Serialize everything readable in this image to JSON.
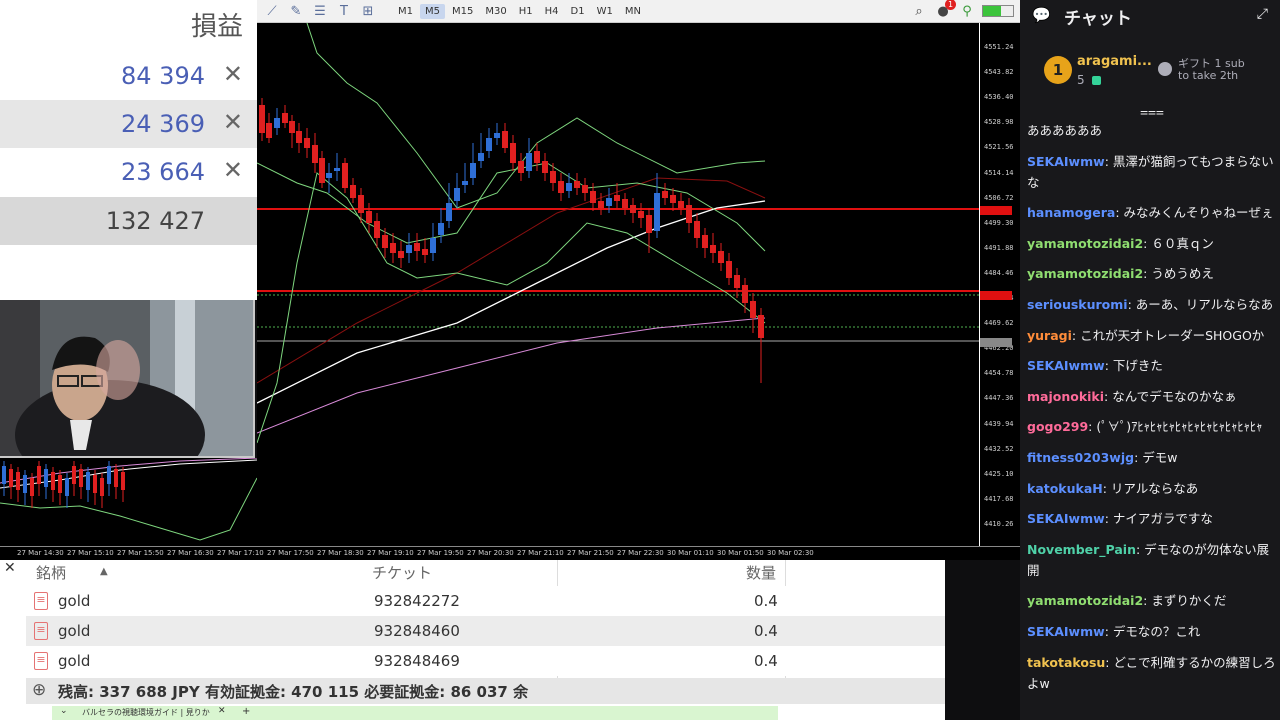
{
  "profit": {
    "header": "損益",
    "rows": [
      {
        "value": "84 394",
        "close": "✕"
      },
      {
        "value": "24 369",
        "close": "✕"
      },
      {
        "value": "23 664",
        "close": "✕"
      }
    ],
    "total": "132 427"
  },
  "toolbar": {
    "timeframes": [
      "M1",
      "M5",
      "M15",
      "M30",
      "H1",
      "H4",
      "D1",
      "W1",
      "MN"
    ],
    "active": "M5",
    "notification_count": "1"
  },
  "chart": {
    "prices": [
      "4551.24",
      "4543.82",
      "4536.40",
      "4528.98",
      "4521.56",
      "4514.14",
      "4506.72",
      "4499.30",
      "4491.88",
      "4484.46",
      "4477.04",
      "4469.62",
      "4462.20",
      "4454.78",
      "4447.36",
      "4439.94",
      "4432.52",
      "4425.10",
      "4417.68",
      "4410.26"
    ],
    "times": [
      "27 Mar 14:30",
      "27 Mar 15:10",
      "27 Mar 15:50",
      "27 Mar 16:30",
      "27 Mar 17:10",
      "27 Mar 17:50",
      "27 Mar 18:30",
      "27 Mar 19:10",
      "27 Mar 19:50",
      "27 Mar 20:30",
      "27 Mar 21:10",
      "27 Mar 21:50",
      "27 Mar 22:30",
      "30 Mar 01:10",
      "30 Mar 01:50",
      "30 Mar 02:30"
    ],
    "colors": {
      "up": "#2f6fd6",
      "down": "#e02020",
      "bb": "#7ed67e",
      "ma_white": "#ffffff",
      "ma_pink": "#d88ad8",
      "ma_red": "#8a1010",
      "line_red": "#e01010",
      "line_green": "#4fb04f"
    }
  },
  "trades": {
    "headers": {
      "symbol": "銘柄",
      "ticket": "チケット",
      "volume": "数量"
    },
    "rows": [
      {
        "symbol": "gold",
        "ticket": "932842272",
        "volume": "0.4"
      },
      {
        "symbol": "gold",
        "ticket": "932848460",
        "volume": "0.4"
      },
      {
        "symbol": "gold",
        "ticket": "932848469",
        "volume": "0.4"
      }
    ],
    "status": "残高: 337 688 JPY  有効証拠金: 470 115  必要証拠金: 86 037  余"
  },
  "taskbar": {
    "tab_title": "バルセラの視聴環境ガイド | 見りか"
  },
  "chat": {
    "title": "チャット",
    "leader": {
      "rank": "1",
      "name": "aragami...",
      "count": "5",
      "gift": "ギフト 1 sub",
      "gift2": "to take 2th"
    },
    "messages": [
      {
        "user": "",
        "color": "#efeff1",
        "text": "ああああああ"
      },
      {
        "user": "SEKAIwmw",
        "color": "#5c8fff",
        "text": "黒澤が猫飼ってもつまらないな"
      },
      {
        "user": "hanamogera",
        "color": "#5c8fff",
        "text": "みなみくんそりゃねーぜぇ"
      },
      {
        "user": "yamamotozidai2",
        "color": "#8fdd70",
        "text": "６０真ｑン"
      },
      {
        "user": "yamamotozidai2",
        "color": "#8fdd70",
        "text": "うめうめえ"
      },
      {
        "user": "seriouskuromi",
        "color": "#5c8fff",
        "text": "あーあ、リアルならなあ"
      },
      {
        "user": "yuragi",
        "color": "#ff8c3a",
        "text": "これが天才トレーダーSHOGOか"
      },
      {
        "user": "SEKAIwmw",
        "color": "#5c8fff",
        "text": "下げきた"
      },
      {
        "user": "majonokiki",
        "color": "#ff6b9a",
        "text": "なんでデモなのかなぁ"
      },
      {
        "user": "gogo299",
        "color": "#ff6b9a",
        "text": "(ﾟ∀ﾟ)ｱﾋｬﾋｬﾋｬﾋｬﾋｬﾋｬﾋｬﾋｬﾋｬﾋｬ"
      },
      {
        "user": "fitness0203wjg",
        "color": "#5c8fff",
        "text": "デモw"
      },
      {
        "user": "katokukaH",
        "color": "#5c8fff",
        "text": "リアルならなあ"
      },
      {
        "user": "SEKAIwmw",
        "color": "#5c8fff",
        "text": "ナイアガラですな"
      },
      {
        "user": "November_Pain",
        "color": "#4fd1a8",
        "text": "デモなのが勿体ない展開"
      },
      {
        "user": "yamamotozidai2",
        "color": "#8fdd70",
        "text": "まずりかくだ"
      },
      {
        "user": "SEKAIwmw",
        "color": "#5c8fff",
        "text": "デモなの？これ"
      },
      {
        "user": "takotakosu",
        "color": "#f0c24f",
        "text": "どこで利確するかの練習しろよw"
      }
    ]
  }
}
